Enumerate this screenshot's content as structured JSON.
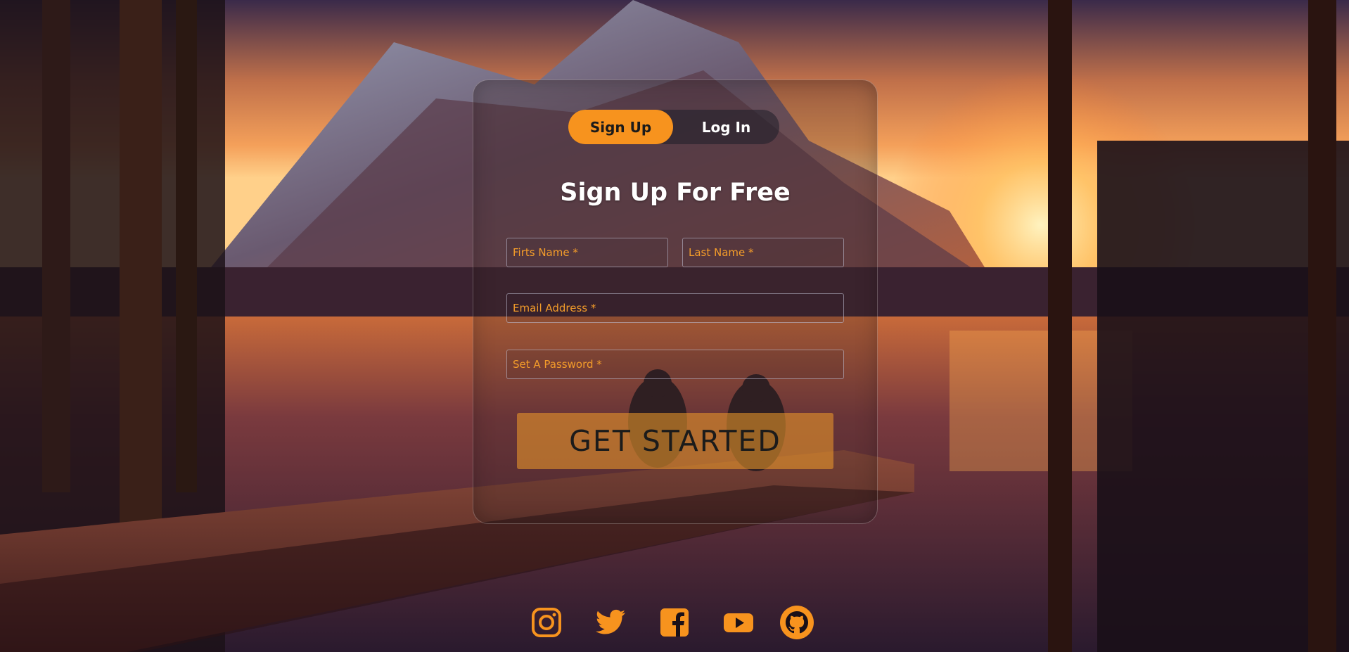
{
  "colors": {
    "accent": "#f7931e",
    "field_text": "#f39c2a",
    "title": "#ffffff"
  },
  "tabs": {
    "signup_label": "Sign Up",
    "login_label": "Log In",
    "active": "signup"
  },
  "form": {
    "title": "Sign Up For Free",
    "first_name_placeholder": "Firts Name *",
    "last_name_placeholder": "Last Name *",
    "email_placeholder": "Email Address *",
    "password_placeholder": "Set A Password *",
    "submit_label": "GET STARTED"
  },
  "socials": {
    "items": [
      {
        "icon": "instagram-icon"
      },
      {
        "icon": "twitter-icon"
      },
      {
        "icon": "facebook-icon"
      },
      {
        "icon": "youtube-icon"
      },
      {
        "icon": "github-icon"
      }
    ]
  }
}
